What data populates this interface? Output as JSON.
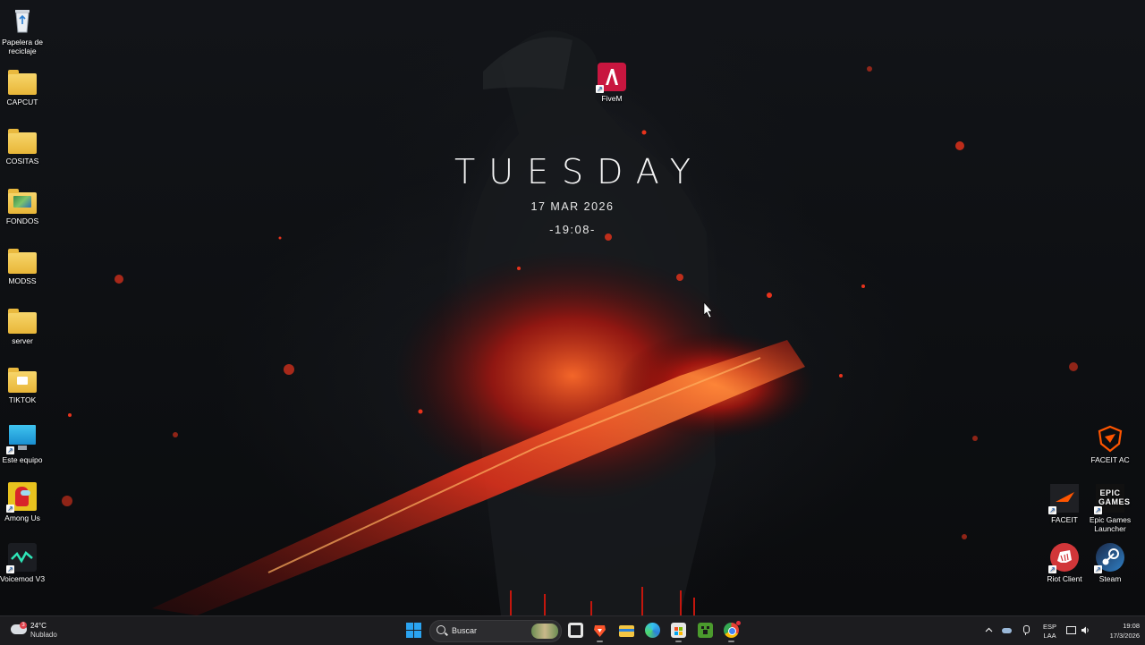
{
  "widget": {
    "day": "TUESDAY",
    "date": "17 MAR 2026",
    "time": "-19:08-"
  },
  "desktop_icons_left": [
    {
      "label": "Papelera de reciclaje",
      "icon": "recycle-bin-icon"
    },
    {
      "label": "CAPCUT",
      "icon": "folder-icon"
    },
    {
      "label": "COSITAS",
      "icon": "folder-icon"
    },
    {
      "label": "FONDOS",
      "icon": "folder-icon"
    },
    {
      "label": "MODSS",
      "icon": "folder-icon"
    },
    {
      "label": "server",
      "icon": "folder-icon"
    },
    {
      "label": "TIKTOK",
      "icon": "folder-icon"
    },
    {
      "label": "Este equipo",
      "icon": "monitor-icon"
    },
    {
      "label": "Among Us",
      "icon": "among-us-icon"
    },
    {
      "label": "Voicemod V3",
      "icon": "voicemod-icon"
    }
  ],
  "desktop_icons_other": {
    "fivem": {
      "label": "FiveM",
      "icon": "fivem-icon"
    },
    "faceit_ac": {
      "label": "FACEIT AC",
      "icon": "faceit-ac-icon"
    },
    "faceit": {
      "label": "FACEIT",
      "icon": "faceit-icon"
    },
    "epic": {
      "label": "Epic Games Launcher",
      "icon": "epic-games-icon",
      "logo_text": "EPIC GAMES"
    },
    "riot": {
      "label": "Riot Client",
      "icon": "riot-client-icon"
    },
    "steam": {
      "label": "Steam",
      "icon": "steam-icon"
    }
  },
  "taskbar": {
    "weather": {
      "temp": "24°C",
      "condition": "Nublado",
      "badge": "3"
    },
    "search_placeholder": "Buscar",
    "apps": [
      "windows-start-icon",
      "task-view-icon",
      "brave-icon",
      "file-explorer-icon",
      "edge-icon",
      "store-icon",
      "minecraft-icon",
      "chrome-icon"
    ],
    "tray": {
      "language": "ESP",
      "layout": "LAA",
      "time": "19:08",
      "date": "17/3/2026"
    }
  },
  "colors": {
    "taskbar_bg": "#1c1c1f",
    "accent_fire": "#e8331c",
    "start_blue": "#2aa3f0"
  }
}
